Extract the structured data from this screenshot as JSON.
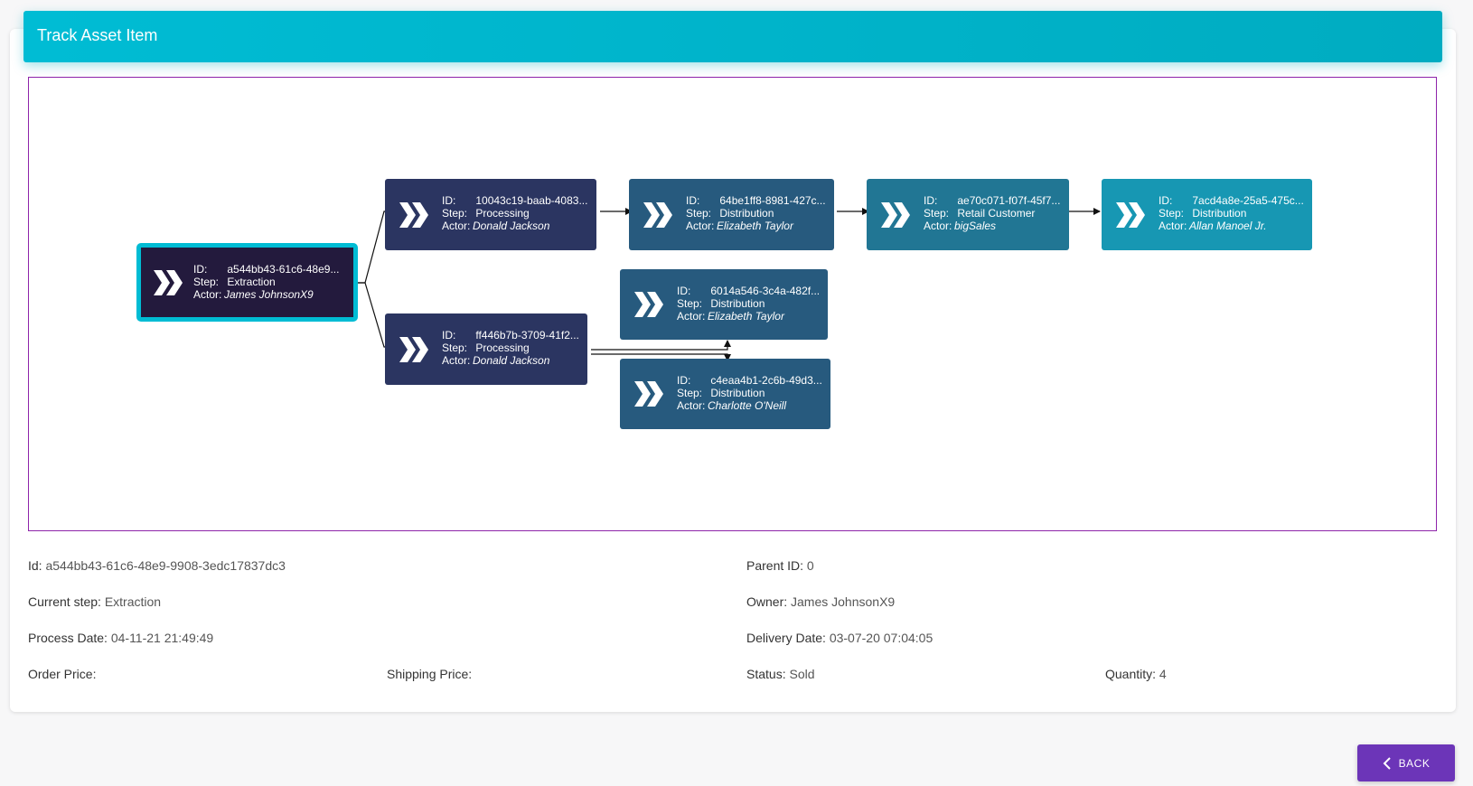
{
  "header": {
    "title": "Track Asset Item"
  },
  "graph": {
    "nodes": [
      {
        "id": "a544bb43-61c6-48e9...",
        "step": "Extraction",
        "actor": "James JohnsonX9",
        "color": "#231a3d"
      },
      {
        "id": "10043c19-baab-4083...",
        "step": "Processing",
        "actor": "Donald Jackson",
        "color": "#2b3561"
      },
      {
        "id": "64be1ff8-8981-427c...",
        "step": "Distribution",
        "actor": "Elizabeth Taylor",
        "color": "#275a7e"
      },
      {
        "id": "ae70c071-f07f-45f7...",
        "step": "Retail Customer",
        "actor": "bigSales",
        "color": "#217694"
      },
      {
        "id": "7acd4a8e-25a5-475c...",
        "step": "Distribution",
        "actor": "Allan Manoel Jr.",
        "color": "#1797b3"
      },
      {
        "id": "ff446b7b-3709-41f2...",
        "step": "Processing",
        "actor": "Donald Jackson",
        "color": "#2b3561"
      },
      {
        "id": "6014a546-3c4a-482f...",
        "step": "Distribution",
        "actor": "Elizabeth Taylor",
        "color": "#275a7e"
      },
      {
        "id": "c4eaa4b1-2c6b-49d3...",
        "step": "Distribution",
        "actor": "Charlotte O'Neill",
        "color": "#275a7e"
      }
    ],
    "labels": {
      "id": "ID:",
      "step": "Step:",
      "actor": "Actor:"
    }
  },
  "details": {
    "id": {
      "label": "Id:",
      "value": "a544bb43-61c6-48e9-9908-3edc17837dc3"
    },
    "parent_id": {
      "label": "Parent ID:",
      "value": "0"
    },
    "current_step": {
      "label": "Current step:",
      "value": "Extraction"
    },
    "owner": {
      "label": "Owner:",
      "value": "James JohnsonX9"
    },
    "process_date": {
      "label": "Process Date:",
      "value": "04-11-21 21:49:49"
    },
    "delivery_date": {
      "label": "Delivery Date:",
      "value": "03-07-20 07:04:05"
    },
    "order_price": {
      "label": "Order Price:",
      "value": ""
    },
    "shipping_price": {
      "label": "Shipping Price:",
      "value": ""
    },
    "status": {
      "label": "Status:",
      "value": "Sold"
    },
    "quantity": {
      "label": "Quantity:",
      "value": "4"
    }
  },
  "back_button": {
    "label": "BACK",
    "icon": "chevron-left-icon"
  },
  "colors": {
    "header": "#00bcd4",
    "graph_border": "#8e24aa",
    "root_border": "#00bcd4",
    "back_button": "#6c35b8"
  }
}
